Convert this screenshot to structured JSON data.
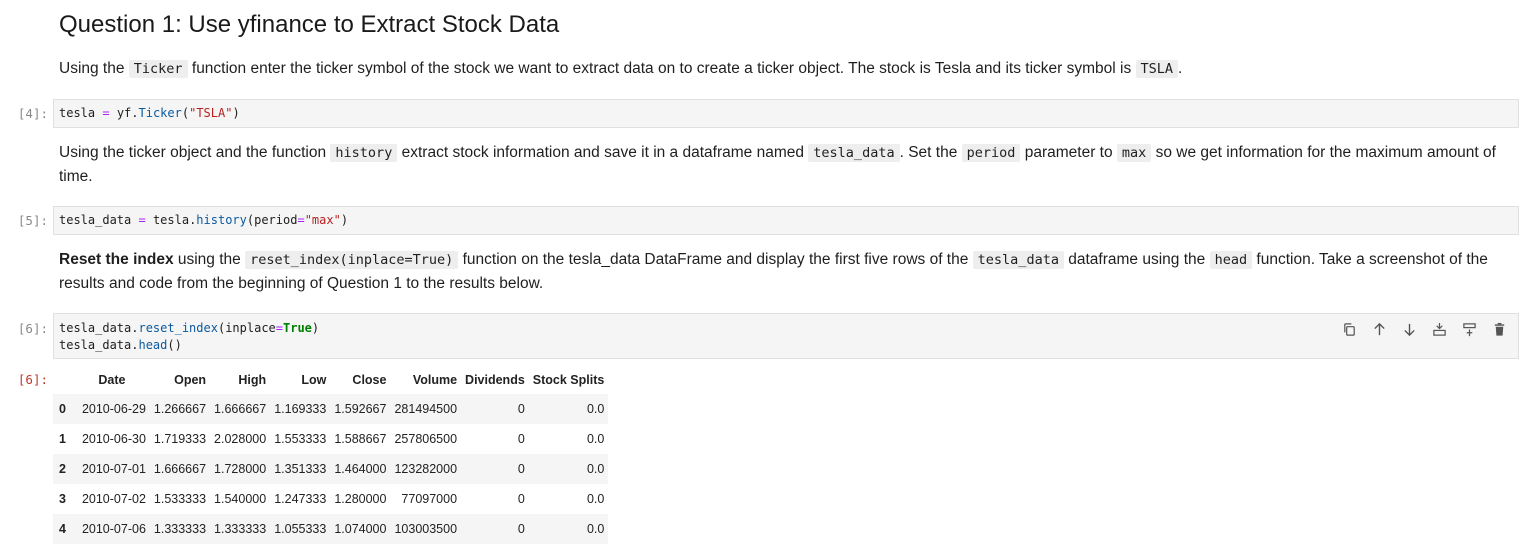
{
  "heading": "Question 1: Use yfinance to Extract Stock Data",
  "md1": {
    "t1": "Using the ",
    "c1": "Ticker",
    "t2": " function enter the ticker symbol of the stock we want to extract data on to create a ticker object. The stock is Tesla and its ticker symbol is ",
    "c2": "TSLA",
    "t3": "."
  },
  "cell4": {
    "prompt": "[4]:",
    "code": {
      "a": "tesla ",
      "op": "=",
      "b": " yf.",
      "fn": "Ticker",
      "c": "(",
      "str": "\"TSLA\"",
      "d": ")"
    }
  },
  "md2": {
    "t1": "Using the ticker object and the function ",
    "c1": "history",
    "t2": " extract stock information and save it in a dataframe named ",
    "c2": "tesla_data",
    "t3": ". Set the ",
    "c3": "period",
    "t4": " parameter to ",
    "c4": "max",
    "t5": " so we get information for the maximum amount of time."
  },
  "cell5": {
    "prompt": "[5]:",
    "code": {
      "a": "tesla_data ",
      "op": "=",
      "b": " tesla.",
      "fn": "history",
      "c": "(period",
      "op2": "=",
      "str": "\"max\"",
      "d": ")"
    }
  },
  "md3": {
    "bold": "Reset the index",
    "t1": " using the ",
    "c1": "reset_index(inplace=True)",
    "t2": " function on the tesla_data DataFrame and display the first five rows of the ",
    "c2": "tesla_data",
    "t3": " dataframe using the ",
    "c3": "head",
    "t4": " function. Take a screenshot of the results and code from the beginning of Question 1 to the results below."
  },
  "cell6": {
    "prompt": "[6]:",
    "line1": {
      "a": "tesla_data.",
      "fn": "reset_index",
      "b": "(inplace",
      "op": "=",
      "kw": "True",
      "c": ")"
    },
    "line2": {
      "a": "tesla_data.",
      "fn": "head",
      "b": "()"
    },
    "toolbar": [
      "copy-icon",
      "arrow-up-icon",
      "arrow-down-icon",
      "insert-above-icon",
      "insert-below-icon",
      "delete-icon"
    ]
  },
  "output6": {
    "prompt": "[6]:",
    "columns": [
      "Date",
      "Open",
      "High",
      "Low",
      "Close",
      "Volume",
      "Dividends",
      "Stock Splits"
    ],
    "rows": [
      {
        "idx": "0",
        "cells": [
          "2010-06-29",
          "1.266667",
          "1.666667",
          "1.169333",
          "1.592667",
          "281494500",
          "0",
          "0.0"
        ]
      },
      {
        "idx": "1",
        "cells": [
          "2010-06-30",
          "1.719333",
          "2.028000",
          "1.553333",
          "1.588667",
          "257806500",
          "0",
          "0.0"
        ]
      },
      {
        "idx": "2",
        "cells": [
          "2010-07-01",
          "1.666667",
          "1.728000",
          "1.351333",
          "1.464000",
          "123282000",
          "0",
          "0.0"
        ]
      },
      {
        "idx": "3",
        "cells": [
          "2010-07-02",
          "1.533333",
          "1.540000",
          "1.247333",
          "1.280000",
          "77097000",
          "0",
          "0.0"
        ]
      },
      {
        "idx": "4",
        "cells": [
          "2010-07-06",
          "1.333333",
          "1.333333",
          "1.055333",
          "1.074000",
          "103003500",
          "0",
          "0.0"
        ]
      }
    ]
  }
}
